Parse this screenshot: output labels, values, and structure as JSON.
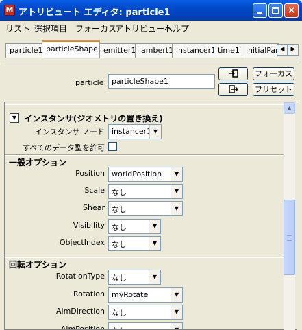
{
  "window": {
    "title": "アトリビュート エディタ: particle1",
    "app_icon": "maya-icon",
    "controls": {
      "minimize": "minimize-icon",
      "maximize": "maximize-icon",
      "close": "×"
    }
  },
  "menu": [
    "リスト",
    "選択項目",
    "フォーカス",
    "アトリビュート",
    "ヘルプ"
  ],
  "tabs": [
    "particle1",
    "particleShape1",
    "emitter1",
    "lambert1",
    "instancer1",
    "time1",
    "initialPart"
  ],
  "tab_scroll": {
    "left": "◀",
    "right": "▶"
  },
  "object": {
    "label": "particle:",
    "value": "particleShape1",
    "focus_label": "フォーカス",
    "preset_label": "プリセット"
  },
  "instancer_section": {
    "title": "インスタンサ(ジオメトリの置き換え)",
    "collapse_glyph": "▼",
    "node_label": "インスタンサ ノード",
    "node_value": "instancer1",
    "allow_all_label": "すべてのデータ型を許可"
  },
  "general_section": {
    "title": "一般オプション",
    "rows": [
      {
        "label": "Position",
        "value": "worldPosition"
      },
      {
        "label": "Scale",
        "value": "なし"
      },
      {
        "label": "Shear",
        "value": "なし"
      },
      {
        "label": "Visibility",
        "value": "なし"
      },
      {
        "label": "ObjectIndex",
        "value": "なし"
      }
    ]
  },
  "rotation_section": {
    "title": "回転オプション",
    "rows": [
      {
        "label": "RotationType",
        "value": "なし"
      },
      {
        "label": "Rotation",
        "value": "myRotate"
      },
      {
        "label": "AimDirection",
        "value": "なし"
      },
      {
        "label": "AimPosition",
        "value": "なし"
      }
    ]
  },
  "dropdown_arrow": "▼"
}
